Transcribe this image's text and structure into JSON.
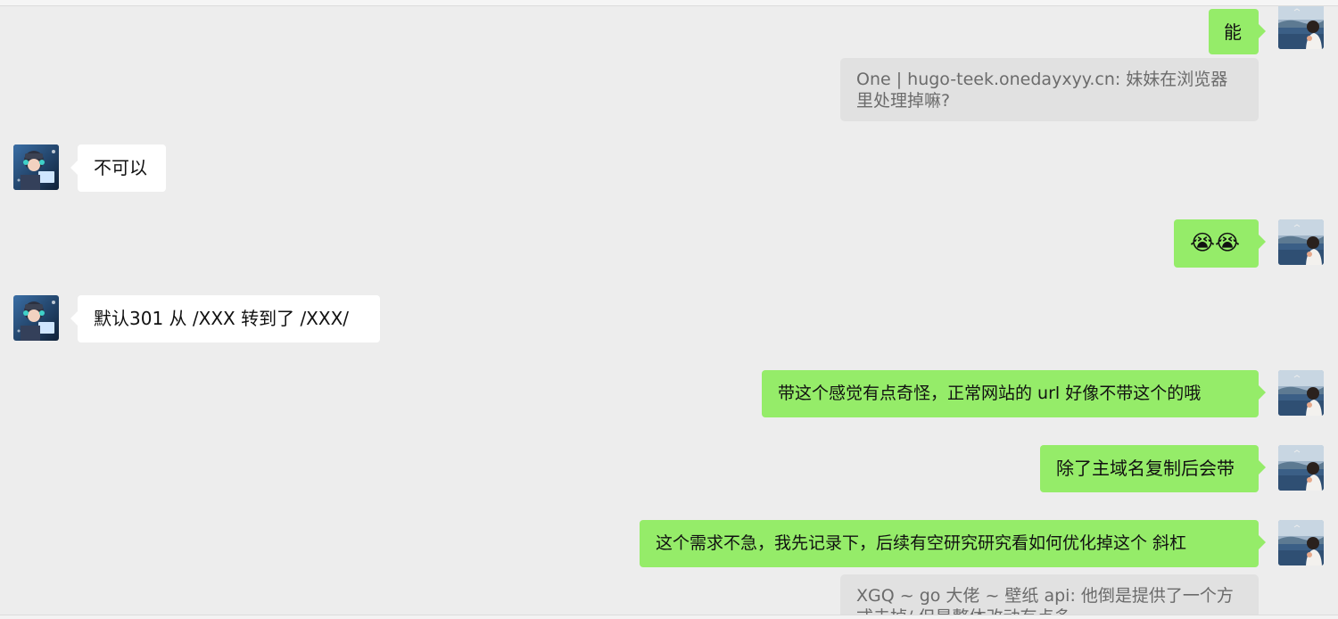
{
  "messages": [
    {
      "side": "me",
      "text": "能"
    },
    {
      "side": "quote",
      "text": "One | hugo-teek.onedayxyy.cn: 妹妹在浏览器里处理掉嘛?"
    },
    {
      "side": "them",
      "text": "不可以"
    },
    {
      "side": "me",
      "text": "😭😭"
    },
    {
      "side": "them",
      "text": "默认301 从 /XXX 转到了  /XXX/"
    },
    {
      "side": "me",
      "text": "带这个感觉有点奇怪，正常网站的 url 好像不带这个的哦"
    },
    {
      "side": "me",
      "text": "除了主域名复制后会带"
    },
    {
      "side": "me",
      "text": "这个需求不急，我先记录下，后续有空研究研究看如何优化掉这个 斜杠"
    },
    {
      "side": "quote",
      "text": "XGQ ~ go 大佬 ~ 壁纸 api: 他倒是提供了一个方式去掉/ 但是整体改动有点多"
    }
  ],
  "emoji_name": "loudly-crying-face"
}
